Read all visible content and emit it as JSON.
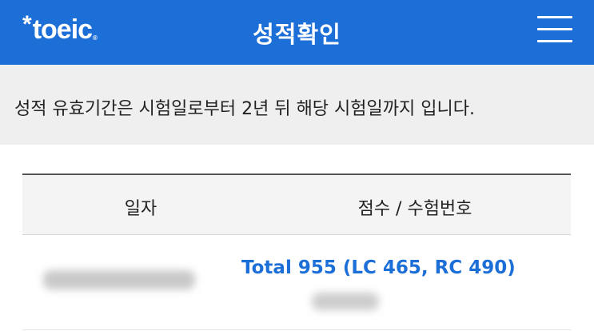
{
  "header": {
    "logo_text": "toeic",
    "logo_star": "*",
    "logo_reg": "®",
    "title": "성적확인",
    "menu_icon": "hamburger-menu-icon",
    "background_color": "#1d6fd8"
  },
  "notice": {
    "text": "성적 유효기간은 시험일로부터 2년 뒤 해당 시험일까지 입니다."
  },
  "table": {
    "columns": [
      "일자",
      "점수 / 수험번호"
    ],
    "rows": [
      {
        "score_text": "Total 955 (LC 465, RC 490)"
      }
    ],
    "score_color": "#1d6fd8"
  }
}
